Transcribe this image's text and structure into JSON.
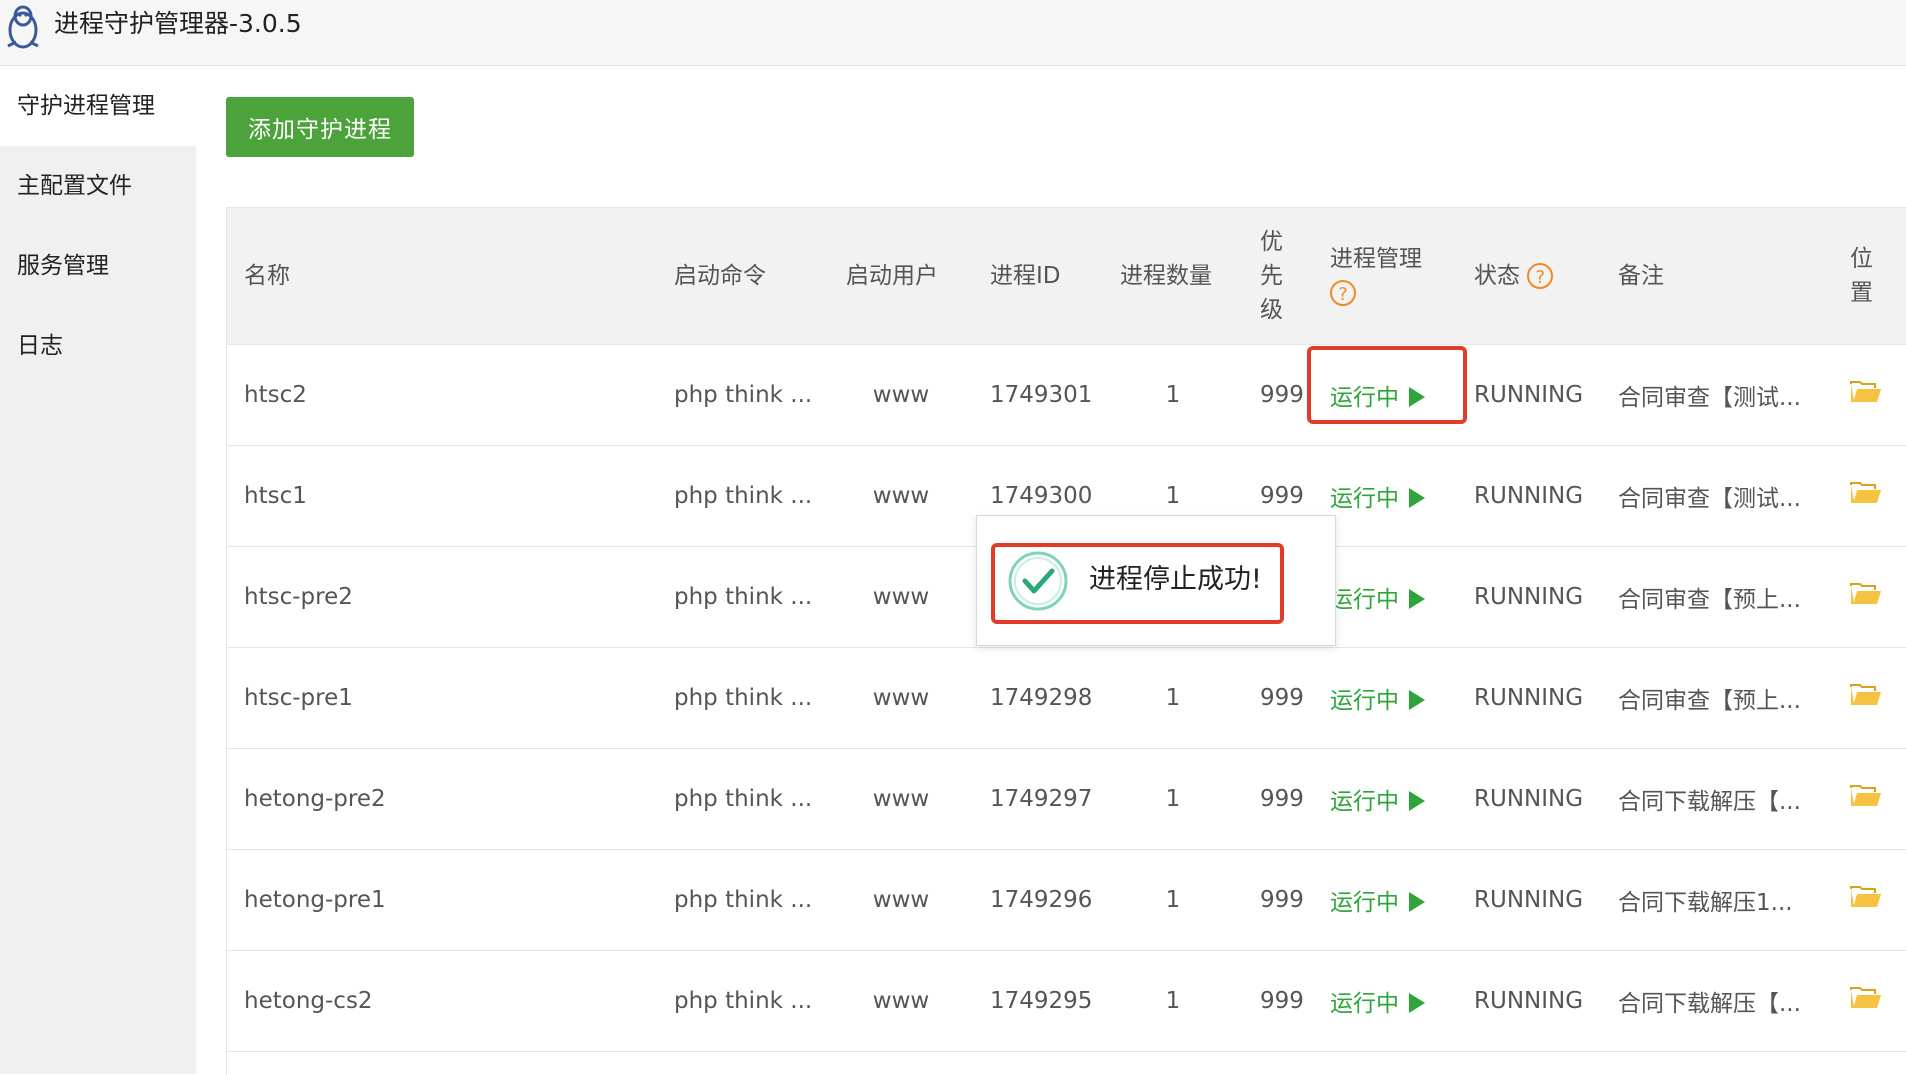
{
  "window": {
    "title": "进程守护管理器-3.0.5",
    "icon": "penguin-icon"
  },
  "sidebar": {
    "items": [
      {
        "label": "守护进程管理",
        "active": true
      },
      {
        "label": "主配置文件",
        "active": false
      },
      {
        "label": "服务管理",
        "active": false
      },
      {
        "label": "日志",
        "active": false
      }
    ]
  },
  "toolbar": {
    "add_label": "添加守护进程"
  },
  "table": {
    "headers": {
      "name": "名称",
      "command": "启动命令",
      "user": "启动用户",
      "pid": "进程ID",
      "count": "进程数量",
      "priority": "优先级",
      "manage": "进程管理",
      "status": "状态",
      "remark": "备注",
      "location": "位置"
    },
    "rows": [
      {
        "name": "htsc2",
        "command": "php think ...",
        "user": "www",
        "pid": "1749301",
        "count": "1",
        "priority": "999",
        "manage": "运行中",
        "status": "RUNNING",
        "remark": "合同审查【测试..."
      },
      {
        "name": "htsc1",
        "command": "php think ...",
        "user": "www",
        "pid": "1749300",
        "count": "1",
        "priority": "999",
        "manage": "运行中",
        "status": "RUNNING",
        "remark": "合同审查【测试..."
      },
      {
        "name": "htsc-pre2",
        "command": "php think ...",
        "user": "www",
        "pid": "",
        "count": "",
        "priority": "",
        "manage": "运行中",
        "status": "RUNNING",
        "remark": "合同审查【预上..."
      },
      {
        "name": "htsc-pre1",
        "command": "php think ...",
        "user": "www",
        "pid": "1749298",
        "count": "1",
        "priority": "999",
        "manage": "运行中",
        "status": "RUNNING",
        "remark": "合同审查【预上..."
      },
      {
        "name": "hetong-pre2",
        "command": "php think ...",
        "user": "www",
        "pid": "1749297",
        "count": "1",
        "priority": "999",
        "manage": "运行中",
        "status": "RUNNING",
        "remark": "合同下载解压【..."
      },
      {
        "name": "hetong-pre1",
        "command": "php think ...",
        "user": "www",
        "pid": "1749296",
        "count": "1",
        "priority": "999",
        "manage": "运行中",
        "status": "RUNNING",
        "remark": "合同下载解压1..."
      },
      {
        "name": "hetong-cs2",
        "command": "php think ...",
        "user": "www",
        "pid": "1749295",
        "count": "1",
        "priority": "999",
        "manage": "运行中",
        "status": "RUNNING",
        "remark": "合同下载解压【..."
      }
    ]
  },
  "toast": {
    "message": "进程停止成功!",
    "icon": "success-check-icon"
  },
  "colors": {
    "accent_green": "#4ca33b",
    "running_green": "#2ea43a",
    "help_orange": "#f08a24",
    "highlight_red": "#e23b2a",
    "folder_yellow": "#f5c242"
  }
}
